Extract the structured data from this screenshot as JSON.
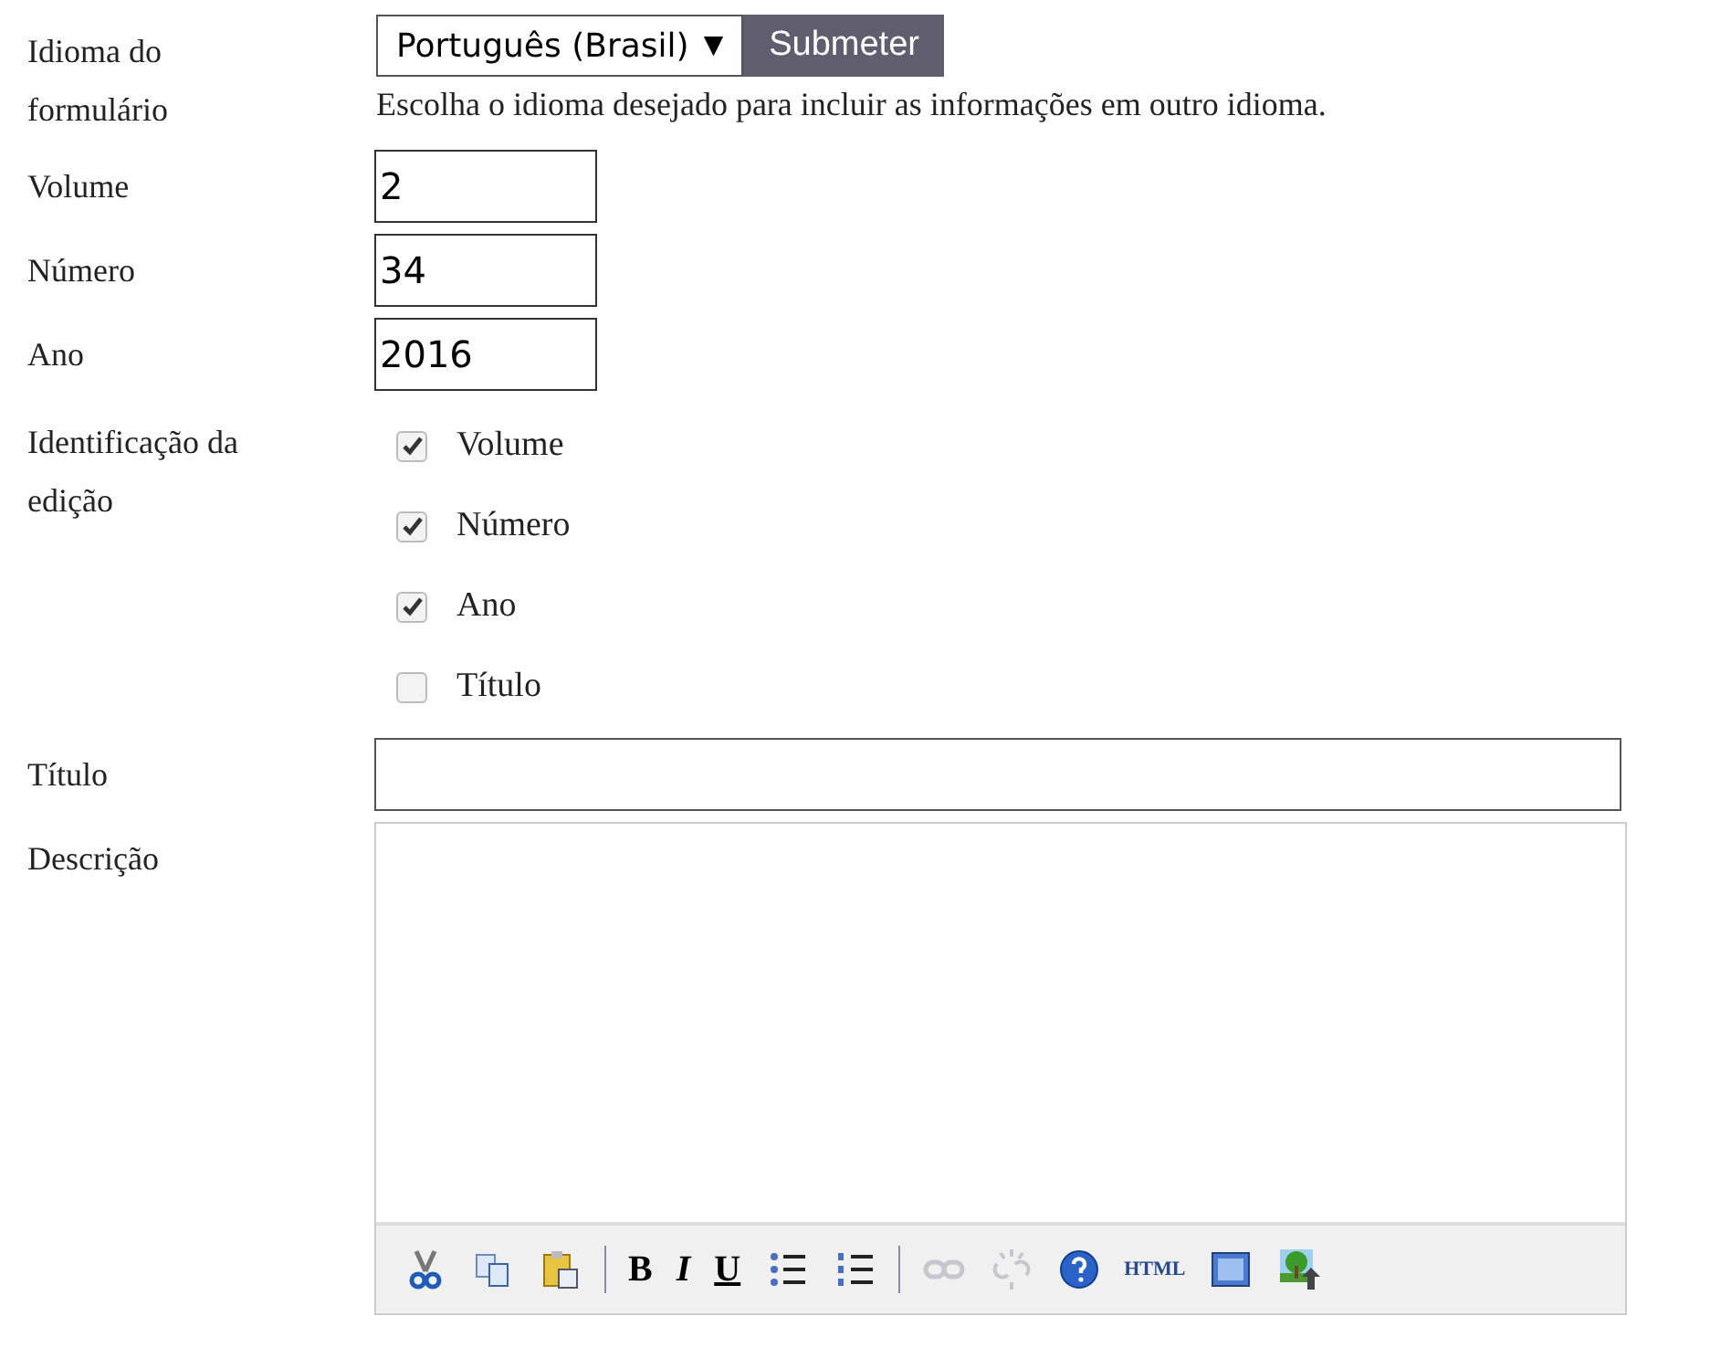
{
  "language": {
    "label": "Idioma do formulário",
    "value": "Português (Brasil)",
    "arrow": "▼",
    "submit": "Submeter",
    "hint": "Escolha o idioma desejado para incluir as informações em outro idioma."
  },
  "fields": [
    {
      "label": "Volume",
      "value": "2"
    },
    {
      "label": "Número",
      "value": "34"
    },
    {
      "label": "Ano",
      "value": "2016"
    }
  ],
  "identification": {
    "label": "Identificação da edição",
    "options": [
      {
        "label": "Volume",
        "checked": true
      },
      {
        "label": "Número",
        "checked": true
      },
      {
        "label": "Ano",
        "checked": true
      },
      {
        "label": "Título",
        "checked": false
      }
    ]
  },
  "title": {
    "label": "Título"
  },
  "description": {
    "label": "Descrição",
    "toolbar": [
      {
        "kind": "cut",
        "disabled": false
      },
      {
        "kind": "copy",
        "disabled": false
      },
      {
        "kind": "paste",
        "disabled": false
      },
      {
        "kind": "separator"
      },
      {
        "kind": "bold",
        "text": "B",
        "disabled": false
      },
      {
        "kind": "italic",
        "text": "I",
        "disabled": false
      },
      {
        "kind": "underline",
        "text": "U",
        "disabled": false
      },
      {
        "kind": "bullets",
        "disabled": false
      },
      {
        "kind": "numbers",
        "disabled": false
      },
      {
        "kind": "separator"
      },
      {
        "kind": "link",
        "disabled": true
      },
      {
        "kind": "unlink",
        "disabled": true
      },
      {
        "kind": "help",
        "disabled": false
      },
      {
        "kind": "html",
        "text": "HTML",
        "disabled": false
      },
      {
        "kind": "template",
        "disabled": false
      },
      {
        "kind": "image",
        "disabled": false
      }
    ]
  }
}
